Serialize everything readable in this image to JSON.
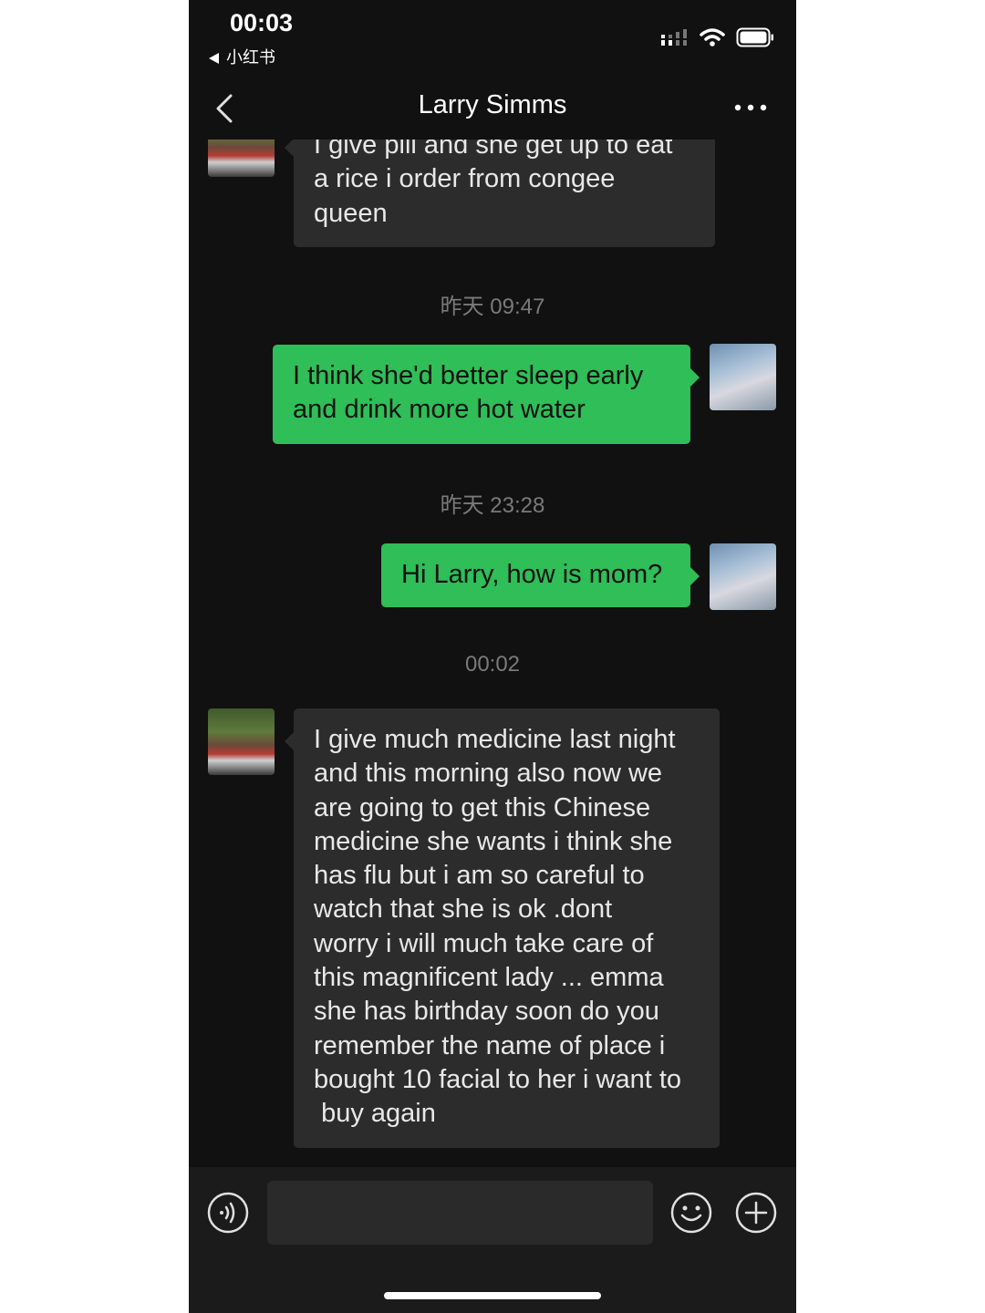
{
  "status_bar": {
    "time": "00:03",
    "back_app": "小红书"
  },
  "nav": {
    "title": "Larry Simms"
  },
  "messages": [
    {
      "sender": "contact",
      "text": "I give pill and she get up to eat\na rice i order from congee\nqueen"
    },
    {
      "type": "timestamp",
      "text": "昨天 09:47"
    },
    {
      "sender": "me",
      "text": "I think she'd better sleep early\nand drink more hot water"
    },
    {
      "type": "timestamp",
      "text": "昨天 23:28"
    },
    {
      "sender": "me",
      "text": "Hi Larry, how is mom?"
    },
    {
      "type": "timestamp",
      "text": "00:02"
    },
    {
      "sender": "contact",
      "text": "I give much medicine last night\nand this morning also now we\nare going to get this Chinese\nmedicine she wants i think she\nhas flu but i am so careful to\nwatch that she is ok .dont\nworry i will much take care of\nthis magnificent lady ... emma\nshe has birthday soon do you\nremember the name of place i\nbought 10 facial to her i want to\n buy again"
    }
  ],
  "input_bar": {
    "voice_icon": "voice-icon",
    "emoji_icon": "emoji-icon",
    "add_icon": "plus-icon"
  },
  "colors": {
    "background": "#111111",
    "incoming_bubble": "#2c2c2c",
    "outgoing_bubble": "#2fbe57",
    "timestamp": "#7a7a7a"
  }
}
